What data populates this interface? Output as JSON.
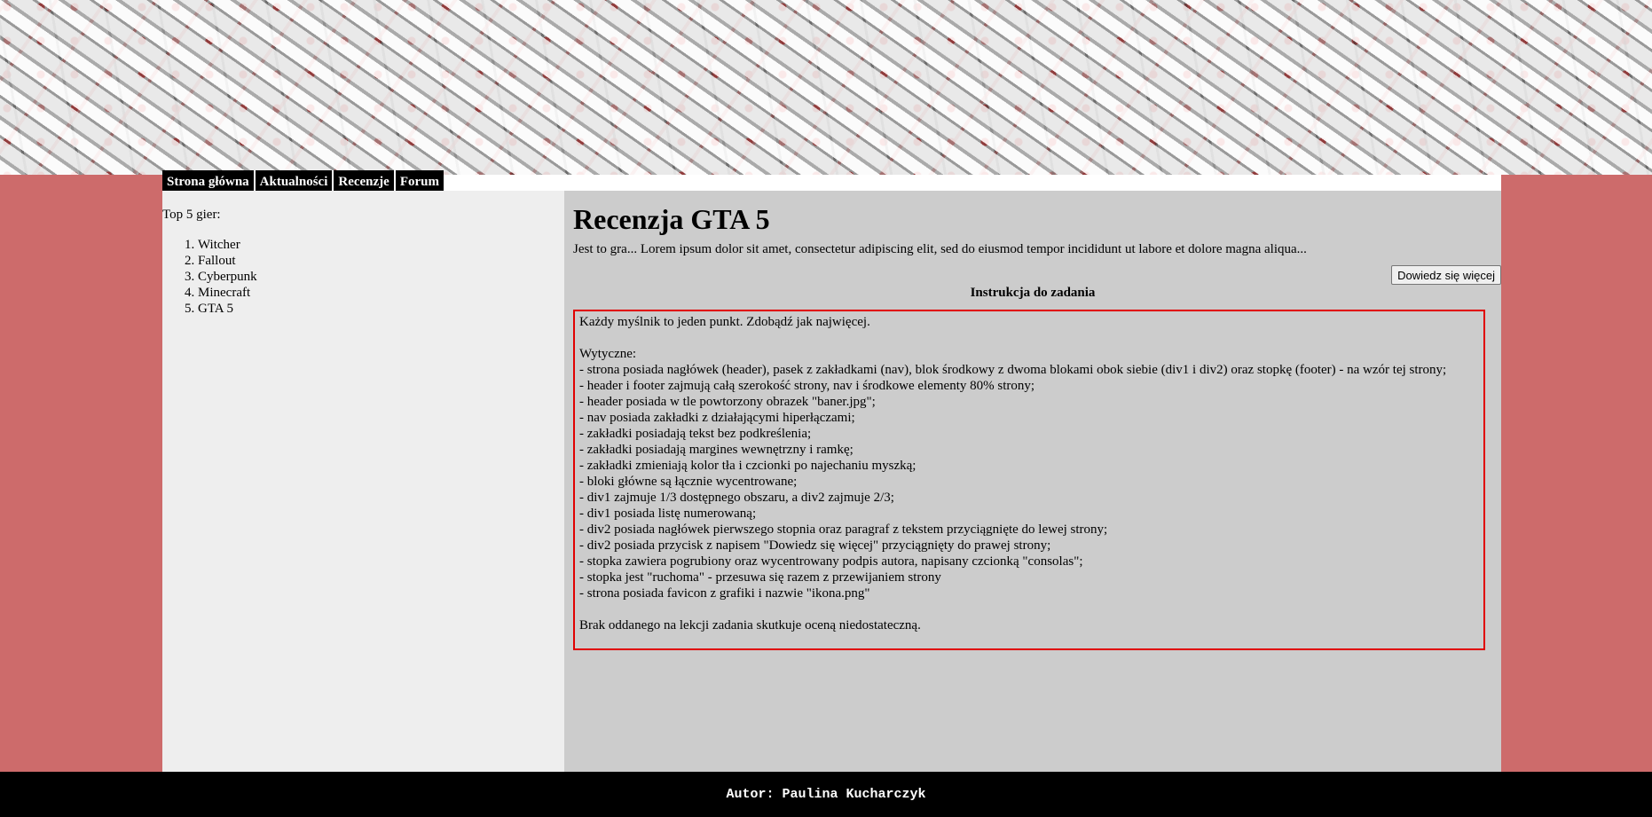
{
  "nav": {
    "tabs": [
      {
        "label": "Strona główna"
      },
      {
        "label": "Aktualności"
      },
      {
        "label": "Recenzje"
      },
      {
        "label": "Forum"
      }
    ]
  },
  "sidebar": {
    "title": "Top 5 gier:",
    "games": [
      "Witcher",
      "Fallout",
      "Cyberpunk",
      "Minecraft",
      "GTA 5"
    ]
  },
  "main": {
    "heading": "Recenzja GTA 5",
    "intro": "Jest to gra... Lorem ipsum dolor sit amet, consectetur adipiscing elit, sed do eiusmod tempor incididunt ut labore et dolore magna aliqua...",
    "button_label": "Dowiedz się więcej",
    "instructions_title": "Instrukcja do zadania",
    "instructions": {
      "intro": "Każdy myślnik to jeden punkt. Zdobądź jak najwięcej.",
      "guidelines_label": "Wytyczne:",
      "items": [
        "- strona posiada nagłówek (header), pasek z zakładkami (nav), blok środkowy z dwoma blokami obok siebie (div1 i div2) oraz stopkę (footer) - na wzór tej strony;",
        "- header i footer zajmują całą szerokość strony, nav i środkowe elementy 80% strony;",
        "- header posiada w tle powtorzony obrazek \"baner.jpg\";",
        "- nav posiada zakładki z działającymi hiperłączami;",
        "- zakładki posiadają tekst bez podkreślenia;",
        "- zakładki posiadają margines wewnętrzny i ramkę;",
        "- zakładki zmieniają kolor tła i czcionki po najechaniu myszką;",
        "- bloki główne są łącznie wycentrowane;",
        "- div1 zajmuje 1/3 dostępnego obszaru, a div2 zajmuje 2/3;",
        "- div1 posiada listę numerowaną;",
        "- div2 posiada nagłówek pierwszego stopnia oraz paragraf z tekstem przyciągnięte do lewej strony;",
        "- div2 posiada przycisk z napisem \"Dowiedz się więcej\" przyciągnięty do prawej strony;",
        "- stopka zawiera pogrubiony oraz wycentrowany podpis autora, napisany czcionką \"consolas\";",
        "- stopka jest \"ruchoma\" - przesuwa się razem z przewijaniem strony",
        "- strona posiada favicon z grafiki i nazwie \"ikona.png\""
      ],
      "closing": "Brak oddanego na lekcji zadania skutkuje oceną niedostateczną."
    }
  },
  "footer": {
    "author": "Autor: Paulina Kucharczyk"
  },
  "colors": {
    "page_background": "#cd6b6b",
    "div1_background": "#eeeeee",
    "div2_background": "#cccccc",
    "instructions_border": "#e00000",
    "nav_tab_background": "#000000",
    "footer_background": "#000000"
  }
}
